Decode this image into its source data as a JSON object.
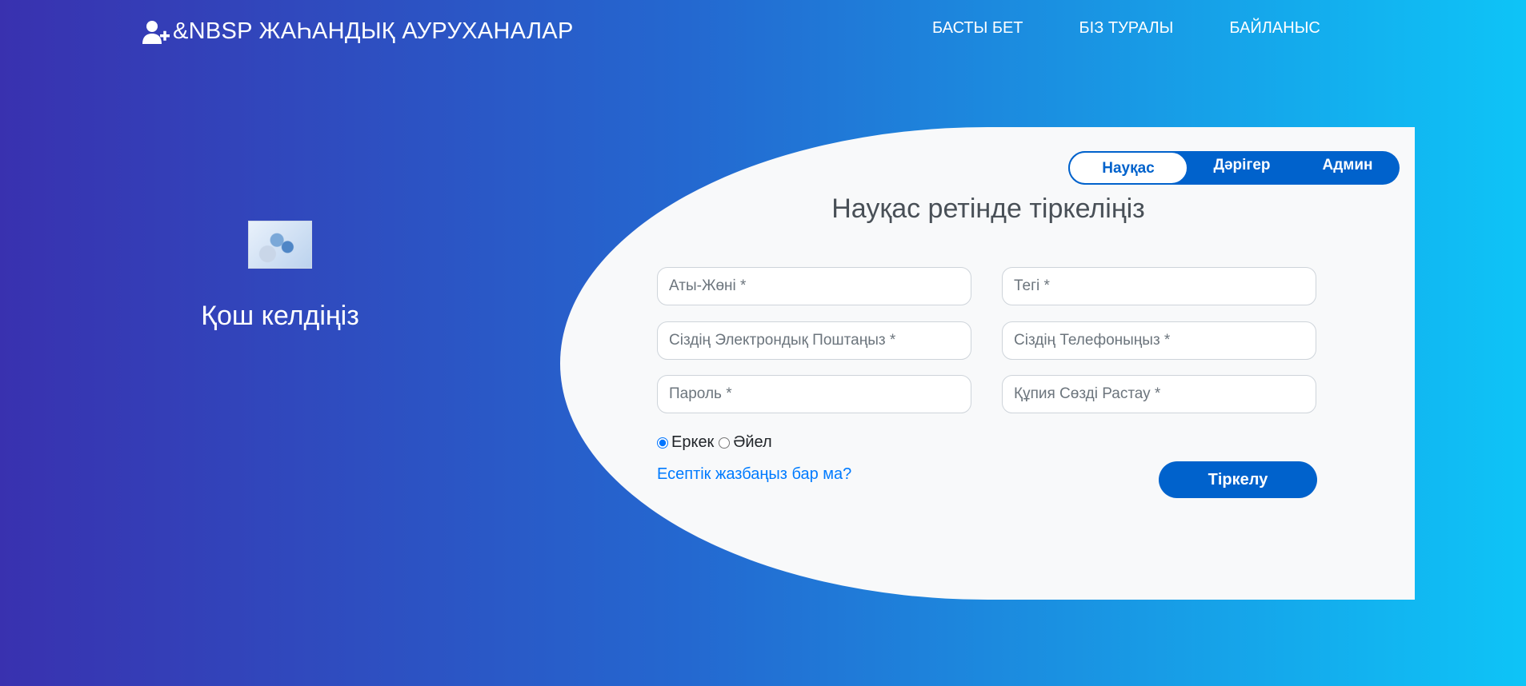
{
  "navbar": {
    "brand": "&NBSP ЖАҺАНДЫҚ АУРУХАНАЛАР",
    "brand_icon": "user-plus-icon",
    "links": [
      "БАСТЫ БЕТ",
      "БІЗ ТУРАЛЫ",
      "БАЙЛАНЫС"
    ]
  },
  "left": {
    "welcome": "Қош келдіңіз"
  },
  "form": {
    "tabs": [
      "Науқас",
      "Дәрігер",
      "Админ"
    ],
    "active_tab": "Науқас",
    "heading": "Науқас ретінде тіркеліңіз",
    "fields": {
      "first_name": "Аты-Жөні *",
      "last_name": "Тегі *",
      "email": "Сіздің Электрондық Поштаңыз *",
      "phone": "Сіздің Телефоныңыз *",
      "password": "Пароль *",
      "confirm_password": "Құпия Сөзді Растау *"
    },
    "gender": {
      "male": "Еркек",
      "female": "Әйел",
      "selected": "Еркек"
    },
    "account_link": "Есептік жазбаңыз бар ма?",
    "submit": "Тіркелу"
  },
  "colors": {
    "accent": "#0062cc",
    "link": "#007bff",
    "gradient_start": "#3931af",
    "gradient_end": "#00c6ff"
  }
}
